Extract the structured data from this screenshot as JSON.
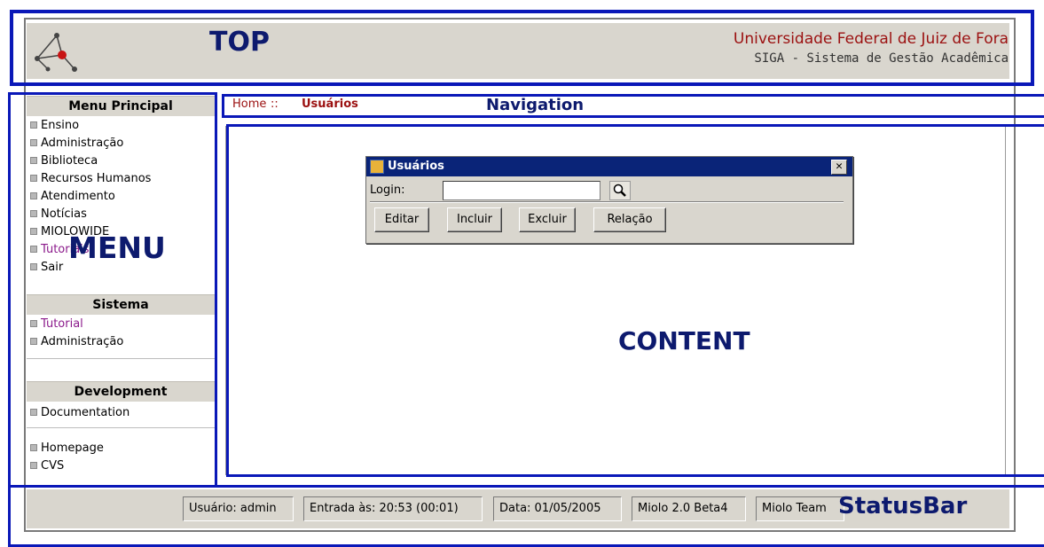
{
  "header": {
    "university": "Universidade Federal de Juiz de Fora",
    "system": "SIGA - Sistema de Gestão Acadêmica",
    "logo_icon": "molecule-logo-icon"
  },
  "sidebar": {
    "menu_principal": {
      "title": "Menu Principal",
      "items": [
        "Ensino",
        "Administração",
        "Biblioteca",
        "Recursos Humanos",
        "Atendimento",
        "Notícias",
        "MIOLOWIDE",
        "Tutoriais",
        "Sair"
      ]
    },
    "sistema": {
      "title": "Sistema",
      "items": [
        "Tutorial",
        "Administração"
      ]
    },
    "development": {
      "title": "Development",
      "items": [
        "Documentation",
        "Homepage",
        "CVS"
      ]
    }
  },
  "navigation": {
    "home": "Home",
    "separator": "::",
    "current": "Usuários"
  },
  "dialog": {
    "title": "Usuários",
    "close_label": "✕",
    "login_label": "Login:",
    "login_value": "",
    "buttons": [
      "Editar",
      "Incluir",
      "Excluir",
      "Relação"
    ]
  },
  "statusbar": {
    "user": "Usuário: admin",
    "entry": "Entrada às: 20:53 (00:01)",
    "date": "Data: 01/05/2005",
    "version": "Miolo 2.0 Beta4",
    "team": "Miolo Team"
  },
  "annotations": {
    "top": "TOP",
    "navigation": "Navigation",
    "menu": "MENU",
    "content": "CONTENT",
    "statusbar": "StatusBar"
  },
  "colors": {
    "annotation_blue": "#0a18b8",
    "univ_red": "#9b1010",
    "titlebar_navy": "#0a2478",
    "panel_beige": "#d9d6ce"
  }
}
